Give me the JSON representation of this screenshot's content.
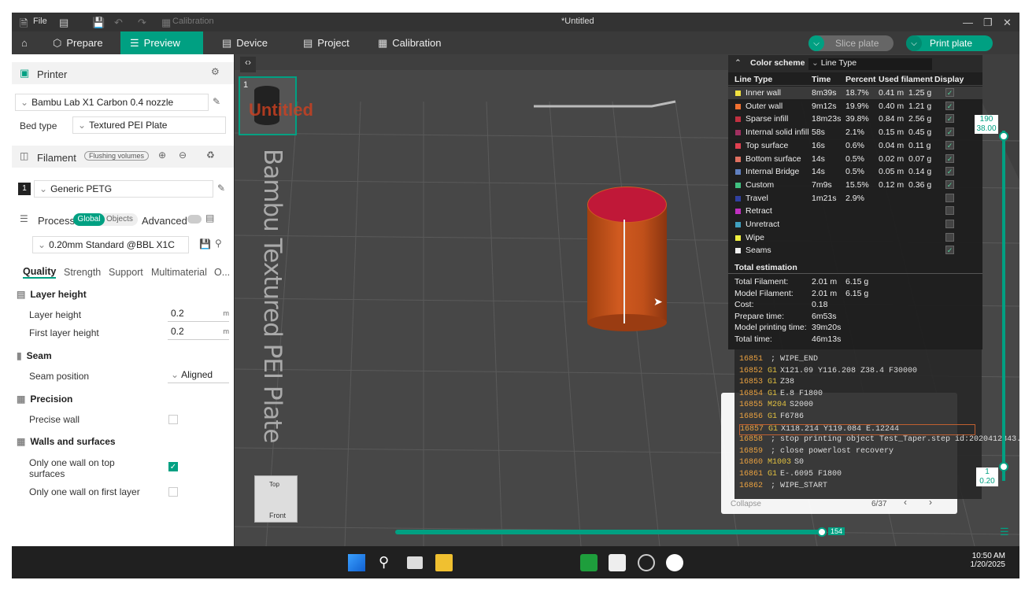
{
  "titlebar": {
    "file": "File",
    "calibration": "Calibration",
    "title": "*Untitled"
  },
  "nav": {
    "prepare": "Prepare",
    "preview": "Preview",
    "device": "Device",
    "project": "Project",
    "calibration": "Calibration",
    "slice_plate": "Slice plate",
    "print_plate": "Print plate"
  },
  "left": {
    "printer_label": "Printer",
    "printer_value": "Bambu Lab X1 Carbon 0.4 nozzle",
    "bed_type_label": "Bed type",
    "bed_type_value": "Textured PEI Plate",
    "filament_label": "Filament",
    "flushing_volumes": "Flushing volumes",
    "filament_index": "1",
    "filament_value": "Generic PETG",
    "process_label": "Process",
    "global": "Global",
    "objects": "Objects",
    "advanced": "Advanced",
    "process_value": "0.20mm Standard @BBL X1C",
    "tabs": [
      "Quality",
      "Strength",
      "Support",
      "Multimaterial",
      "O..."
    ],
    "sections": {
      "layer_height": "Layer height",
      "layer_height_label": "Layer height",
      "layer_height_value": "0.2",
      "first_layer_height_label": "First layer height",
      "first_layer_height_value": "0.2",
      "unit": "m",
      "seam": "Seam",
      "seam_position_label": "Seam position",
      "seam_position_value": "Aligned",
      "precision": "Precision",
      "precise_wall_label": "Precise wall",
      "walls": "Walls and surfaces",
      "one_wall_top_label_1": "Only one wall on top",
      "one_wall_top_label_2": "surfaces",
      "one_wall_first_label": "Only one wall on first layer"
    }
  },
  "plate": {
    "number": "1",
    "bed_text": "Bambu Textured PEI Plate",
    "label": "Untitled"
  },
  "legend": {
    "title": "Color scheme",
    "scheme": "Line Type",
    "headers": [
      "Line Type",
      "Time",
      "Percent",
      "Used filament",
      "Display"
    ],
    "rows": [
      {
        "name": "Inner wall",
        "time": "8m39s",
        "percent": "18.7%",
        "len": "0.41 m",
        "weight": "1.25 g",
        "color": "#f0e040",
        "display": true
      },
      {
        "name": "Outer wall",
        "time": "9m12s",
        "percent": "19.9%",
        "len": "0.40 m",
        "weight": "1.21 g",
        "color": "#f07030",
        "display": true
      },
      {
        "name": "Sparse infill",
        "time": "18m23s",
        "percent": "39.8%",
        "len": "0.84 m",
        "weight": "2.56 g",
        "color": "#c03040",
        "display": true
      },
      {
        "name": "Internal solid infill",
        "time": "58s",
        "percent": "2.1%",
        "len": "0.15 m",
        "weight": "0.45 g",
        "color": "#a03060",
        "display": true
      },
      {
        "name": "Top surface",
        "time": "16s",
        "percent": "0.6%",
        "len": "0.04 m",
        "weight": "0.11 g",
        "color": "#e04050",
        "display": true
      },
      {
        "name": "Bottom surface",
        "time": "14s",
        "percent": "0.5%",
        "len": "0.02 m",
        "weight": "0.07 g",
        "color": "#e07060",
        "display": true
      },
      {
        "name": "Internal Bridge",
        "time": "14s",
        "percent": "0.5%",
        "len": "0.05 m",
        "weight": "0.14 g",
        "color": "#6080c0",
        "display": true
      },
      {
        "name": "Custom",
        "time": "7m9s",
        "percent": "15.5%",
        "len": "0.12 m",
        "weight": "0.36 g",
        "color": "#40c080",
        "display": true
      },
      {
        "name": "Travel",
        "time": "1m21s",
        "percent": "2.9%",
        "len": "",
        "weight": "",
        "color": "#3040a0",
        "display": false
      },
      {
        "name": "Retract",
        "time": "",
        "percent": "",
        "len": "",
        "weight": "",
        "color": "#c030c0",
        "display": false
      },
      {
        "name": "Unretract",
        "time": "",
        "percent": "",
        "len": "",
        "weight": "",
        "color": "#40a0c0",
        "display": false
      },
      {
        "name": "Wipe",
        "time": "",
        "percent": "",
        "len": "",
        "weight": "",
        "color": "#f0f040",
        "display": false
      },
      {
        "name": "Seams",
        "time": "",
        "percent": "",
        "len": "",
        "weight": "",
        "color": "#f0f0f0",
        "display": true
      }
    ],
    "total_title": "Total estimation",
    "totals": [
      {
        "label": "Total Filament:",
        "a": "2.01 m",
        "b": "6.15 g"
      },
      {
        "label": "Model Filament:",
        "a": "2.01 m",
        "b": "6.15 g"
      },
      {
        "label": "Cost:",
        "a": "0.18",
        "b": ""
      },
      {
        "label": "Prepare time:",
        "a": "6m53s",
        "b": ""
      },
      {
        "label": "Model printing time:",
        "a": "39m20s",
        "b": ""
      },
      {
        "label": "Total time:",
        "a": "46m13s",
        "b": ""
      }
    ]
  },
  "gcode": [
    {
      "n": "16851",
      "c": "",
      "t": "; WIPE_END"
    },
    {
      "n": "16852",
      "c": "G1",
      "t": "X121.09 Y116.208 Z38.4 F30000"
    },
    {
      "n": "16853",
      "c": "G1",
      "t": "Z38"
    },
    {
      "n": "16854",
      "c": "G1",
      "t": "E.8 F1800"
    },
    {
      "n": "16855",
      "c": "M204",
      "t": "S2000"
    },
    {
      "n": "16856",
      "c": "G1",
      "t": "F6786"
    },
    {
      "n": "16857",
      "c": "G1",
      "t": "X118.214 Y119.084 E.12244"
    },
    {
      "n": "16858",
      "c": "",
      "t": "; stop printing object Test_Taper.step id:2020412343..."
    },
    {
      "n": "16859",
      "c": "",
      "t": "; close powerlost recovery"
    },
    {
      "n": "16860",
      "c": "M1003",
      "t": "S0"
    },
    {
      "n": "16861",
      "c": "G1",
      "t": "E-.6095 F1800"
    },
    {
      "n": "16862",
      "c": "",
      "t": "; WIPE_START"
    }
  ],
  "popup": {
    "collapse": "Collapse",
    "page": "6/37"
  },
  "sliders": {
    "v_top_1": "190",
    "v_top_2": "38.00",
    "v_bot_1": "1",
    "v_bot_2": "0.20",
    "h_val": "154"
  },
  "viewcube": {
    "top": "Top",
    "front": "Front"
  },
  "taskbar": {
    "time": "10:50 AM",
    "date": "1/20/2025"
  }
}
